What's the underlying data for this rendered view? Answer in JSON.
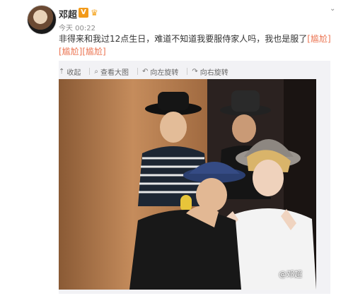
{
  "post": {
    "author": "邓超",
    "verified_badge": "V",
    "time": "今天 00:22",
    "text_main": "非得来和我过12点生日，难道不知道我要服侍家人吗，我也是服了",
    "emoji_tags": [
      "[尴尬]",
      "[尴尬]",
      "[尴尬]"
    ],
    "text_wrap_tail": "尬]"
  },
  "media_toolbar": {
    "collapse": "收起",
    "view_large": "查看大图",
    "rotate_left": "向左旋转",
    "rotate_right": "向右旋转"
  },
  "photo": {
    "watermark": "@邓超"
  },
  "icons": {
    "expand": "chevron-down-icon",
    "collapse": "collapse-up-icon",
    "zoom": "magnifier-icon",
    "rotate_left": "rotate-left-icon",
    "rotate_right": "rotate-right-icon"
  }
}
